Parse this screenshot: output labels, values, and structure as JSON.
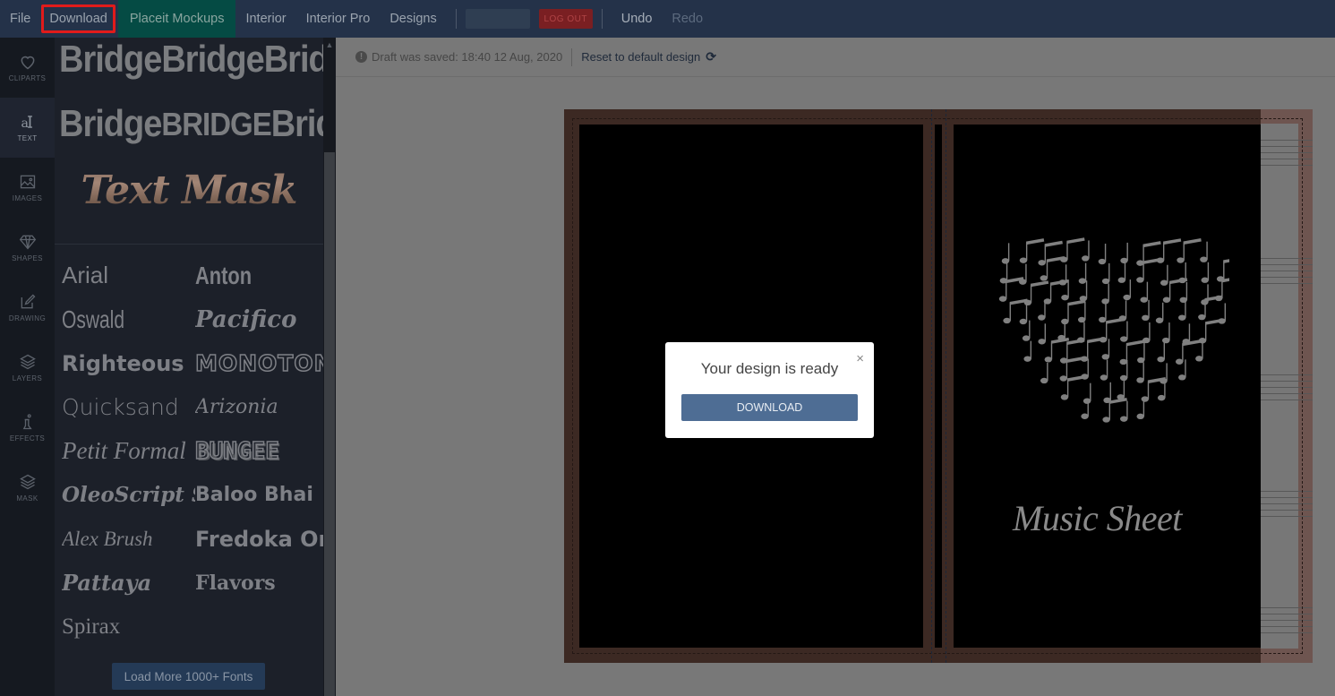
{
  "topbar": {
    "menu": [
      {
        "label": "File"
      },
      {
        "label": "Download"
      },
      {
        "label": "Placeit Mockups"
      },
      {
        "label": "Interior"
      },
      {
        "label": "Interior Pro"
      },
      {
        "label": "Designs"
      }
    ],
    "logout_label": "LOG OUT",
    "undo_label": "Undo",
    "redo_label": "Redo",
    "highlight_color": "#e11b1b"
  },
  "iconbar": {
    "items": [
      {
        "label": "CLIPARTS",
        "icon": "heart-icon"
      },
      {
        "label": "TEXT",
        "icon": "text-icon"
      },
      {
        "label": "IMAGES",
        "icon": "image-icon"
      },
      {
        "label": "SHAPES",
        "icon": "diamond-icon"
      },
      {
        "label": "DRAWING",
        "icon": "pencil-icon"
      },
      {
        "label": "LAYERS",
        "icon": "layers-icon"
      },
      {
        "label": "EFFECTS",
        "icon": "flask-icon"
      },
      {
        "label": "MASK",
        "icon": "layers-icon"
      }
    ],
    "active": "TEXT"
  },
  "text_panel": {
    "curved_presets_row1": [
      "Bridge",
      "Bridge",
      "Bridge"
    ],
    "curved_presets_row2": [
      "Bridge",
      "BRIDGE",
      "Bridge"
    ],
    "text_mask_label": "Text Mask",
    "fonts": [
      "Arial",
      "Anton",
      "Oswald",
      "Pacifico",
      "Righteous",
      "MONOTON",
      "Quicksand",
      "Arizonia",
      "Petit Formal",
      "BUNGEE",
      "OleoScript S",
      "Baloo Bhai",
      "Alex Brush",
      "Fredoka One",
      "Pattaya",
      "Flavors",
      "Spirax"
    ],
    "load_more_label": "Load More 1000+ Fonts"
  },
  "draft_bar": {
    "saved_text": "Draft was saved: 18:40 12 Aug, 2020",
    "reset_label": "Reset to default design"
  },
  "canvas": {
    "cover_title": "Music Sheet",
    "cover_color": "#3c2923"
  },
  "modal": {
    "title": "Your design is ready",
    "button_label": "DOWNLOAD",
    "close_label": "×"
  }
}
